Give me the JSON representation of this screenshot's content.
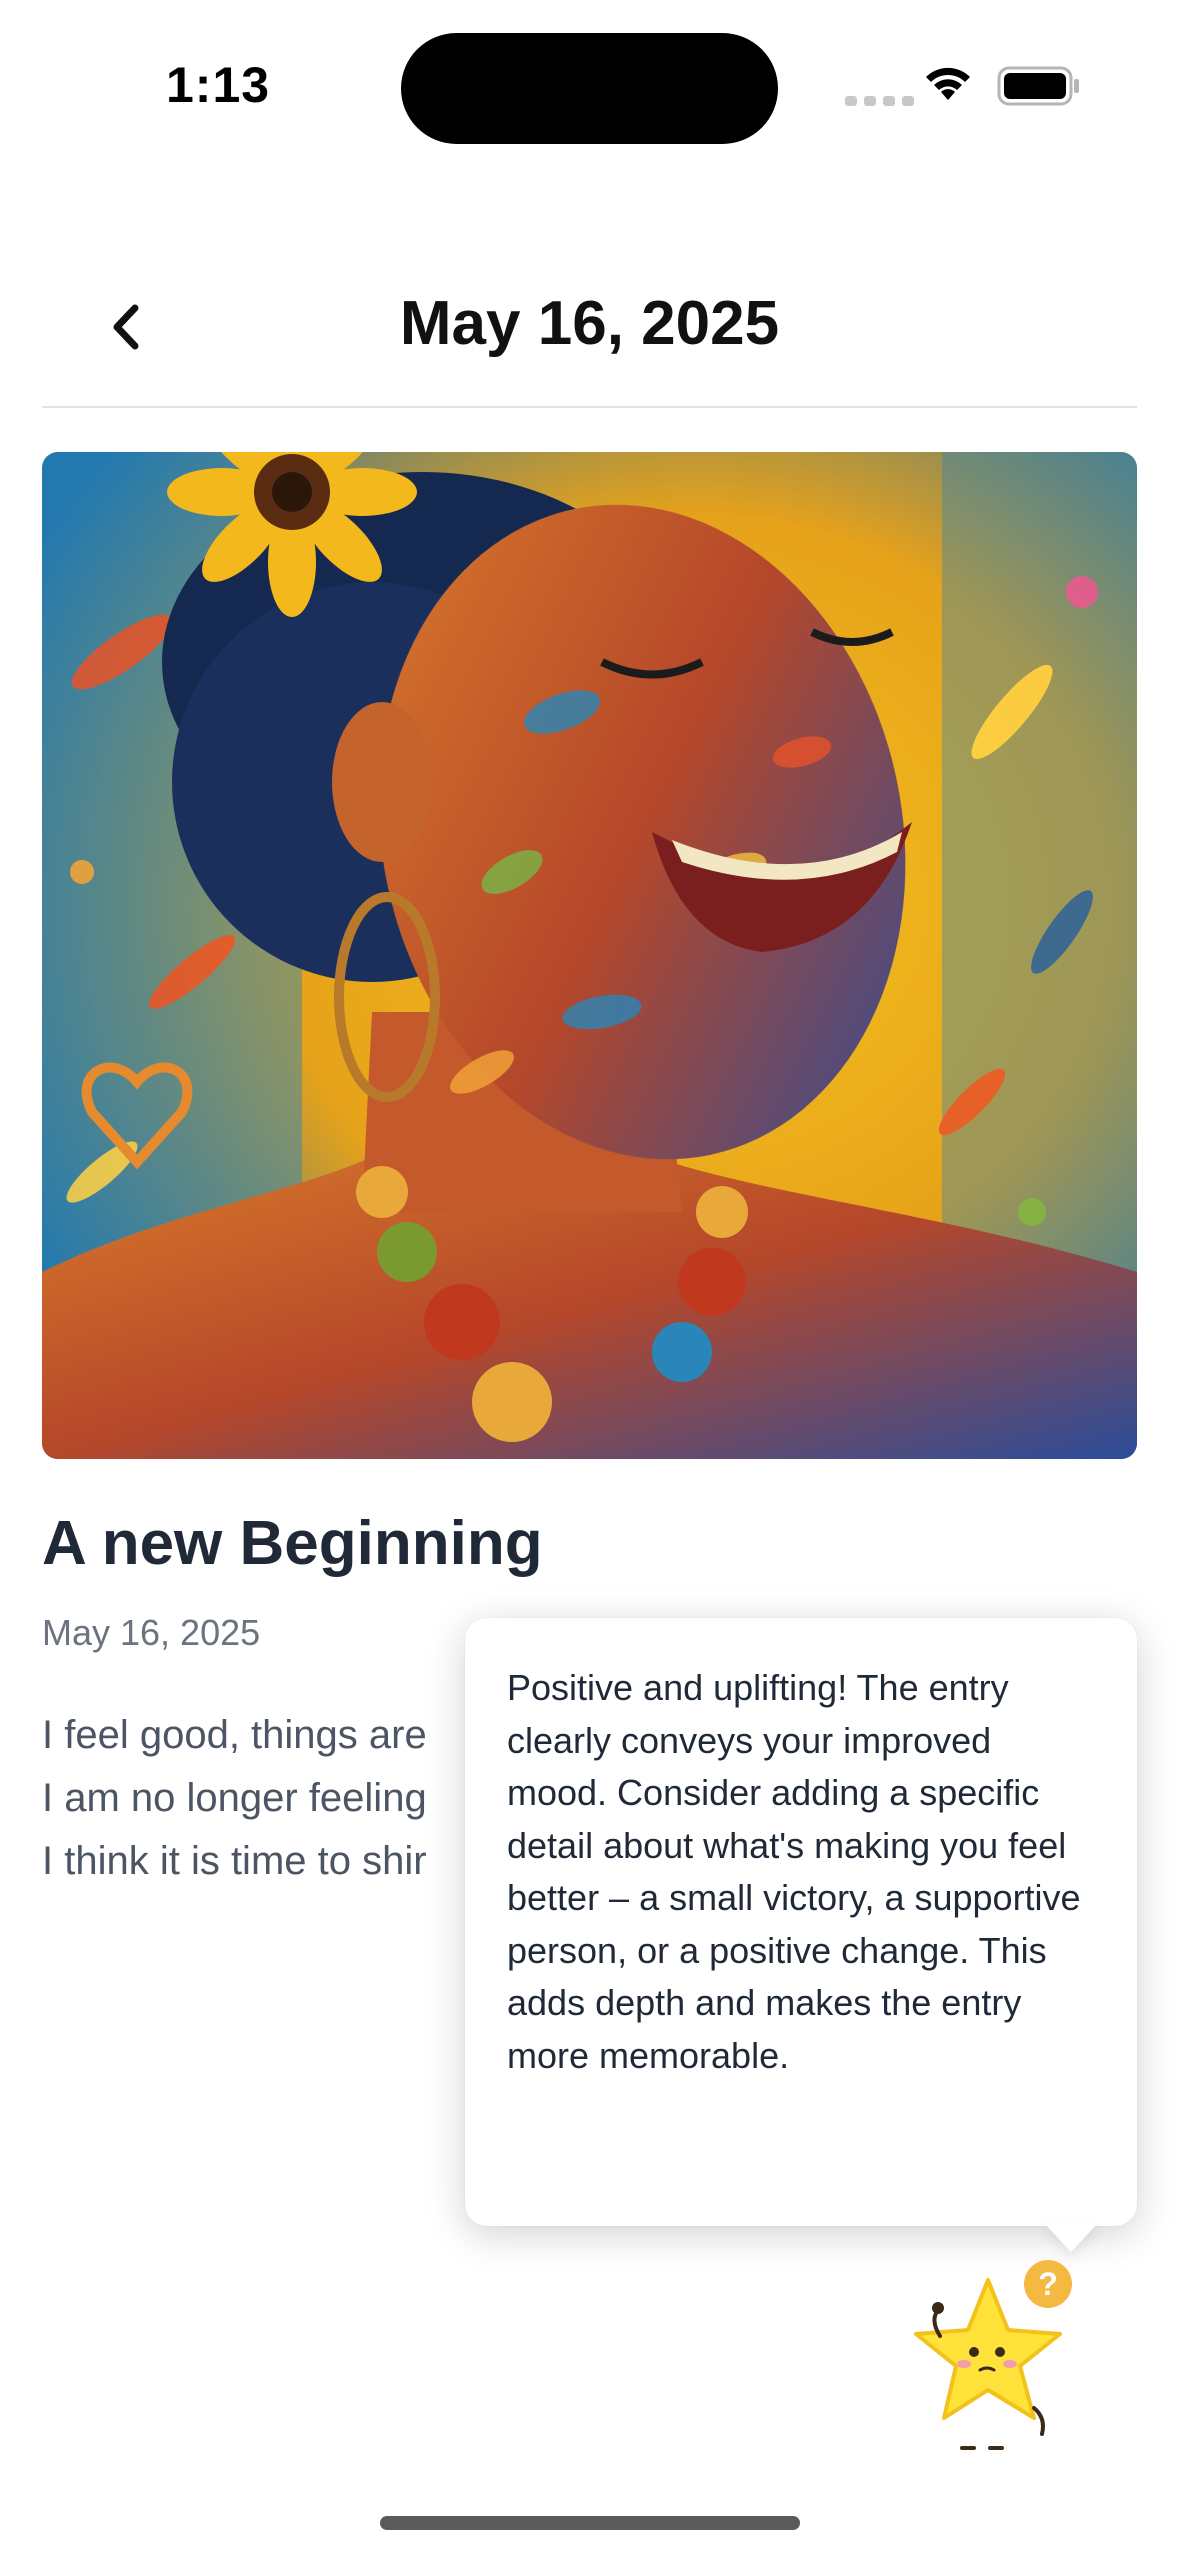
{
  "status_bar": {
    "time": "1:13"
  },
  "header": {
    "title": "May 16, 2025",
    "back_icon": "chevron-left-icon"
  },
  "entry": {
    "title": "A new Beginning",
    "date": "May 16, 2025",
    "body_lines": [
      "I feel good, things are",
      "I am no longer feeling",
      "I think it is time to shir"
    ]
  },
  "feedback_tooltip": {
    "text": "Positive and uplifting!  The entry clearly conveys your improved mood.  Consider adding a specific detail about what's making you feel better –  a small victory,  a supportive person, or a positive change.  This adds depth and makes the entry more memorable."
  },
  "mascot": {
    "icon": "star-mascot-icon",
    "badge_icon": "question-mark-icon"
  },
  "colors": {
    "accent_yellow": "#FFE23A",
    "badge_orange": "#F5B942",
    "text_dark": "#1F2937",
    "text_muted": "#6B7280"
  }
}
